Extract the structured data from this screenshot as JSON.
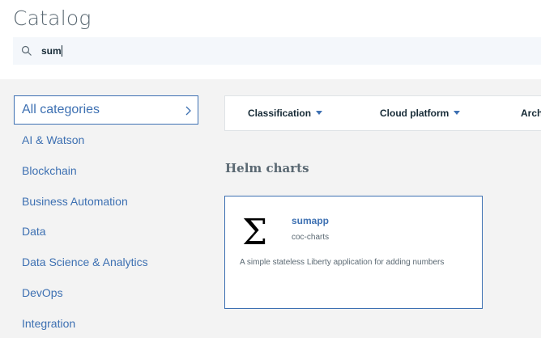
{
  "header": {
    "title": "Catalog",
    "search": {
      "value": "sum",
      "placeholder": ""
    }
  },
  "sidebar": {
    "selected": "All categories",
    "items": [
      "AI & Watson",
      "Blockchain",
      "Business Automation",
      "Data",
      "Data Science & Analytics",
      "DevOps",
      "Integration"
    ]
  },
  "filters": [
    {
      "label": "Classification"
    },
    {
      "label": "Cloud platform"
    },
    {
      "label": "Arch"
    }
  ],
  "results": {
    "section_title": "Helm charts",
    "cards": [
      {
        "icon": "sigma-icon",
        "name": "sumapp",
        "repo": "coc-charts",
        "description": "A simple stateless Liberty application for adding numbers"
      }
    ]
  },
  "colors": {
    "accent": "#3d70b2",
    "text": "#152935",
    "muted": "#5a6872",
    "background": "#f3f3f3"
  }
}
